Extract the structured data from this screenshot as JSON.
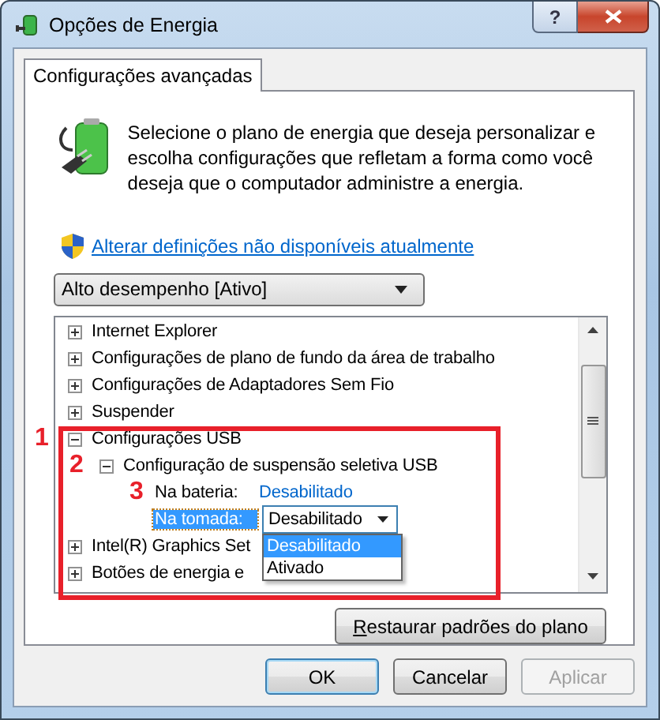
{
  "window": {
    "title": "Opções de Energia",
    "buttons": [
      "?"
    ]
  },
  "tabs": [
    {
      "label": "Configurações avançadas",
      "selected": true
    }
  ],
  "intro": "Selecione o plano de energia que deseja personalizar e escolha configurações que refletam a forma como você deseja que o computador administre a energia.",
  "admin_link": "Alterar definições não disponíveis atualmente",
  "plan_select": {
    "value": "Alto desempenho [Ativo]"
  },
  "settings_tree": [
    {
      "kind": "group",
      "label": "Internet Explorer",
      "expanded": false
    },
    {
      "kind": "group",
      "label": "Configurações de plano de fundo da área de trabalho",
      "expanded": false
    },
    {
      "kind": "group",
      "label": "Configurações de Adaptadores Sem Fio",
      "expanded": false
    },
    {
      "kind": "group",
      "label": "Suspender",
      "expanded": false
    },
    {
      "kind": "group",
      "label": "Configurações USB",
      "expanded": true,
      "callout": "1",
      "children": [
        {
          "kind": "group",
          "label": "Configuração de suspensão seletiva USB",
          "expanded": true,
          "callout": "2",
          "children": [
            {
              "kind": "setting",
              "label": "Na bateria:",
              "value": "Desabilitado",
              "selected": false,
              "callout": "3"
            },
            {
              "kind": "setting",
              "label": "Na tomada:",
              "value": "Desabilitado",
              "selected": true,
              "options": [
                {
                  "label": "Desabilitado",
                  "selected": true
                },
                {
                  "label": "Ativado",
                  "selected": false
                }
              ]
            }
          ]
        }
      ]
    },
    {
      "kind": "group",
      "label": "Intel(R) Graphics Set",
      "expanded": false
    },
    {
      "kind": "group",
      "label": "Botões de energia e",
      "expanded": false
    }
  ],
  "restore_button": "Restaurar padrões do plano",
  "buttons": [
    {
      "label": "OK",
      "default": true,
      "disabled": false
    },
    {
      "label": "Cancelar",
      "default": false,
      "disabled": false
    },
    {
      "label": "Aplicar",
      "default": false,
      "disabled": true
    }
  ]
}
